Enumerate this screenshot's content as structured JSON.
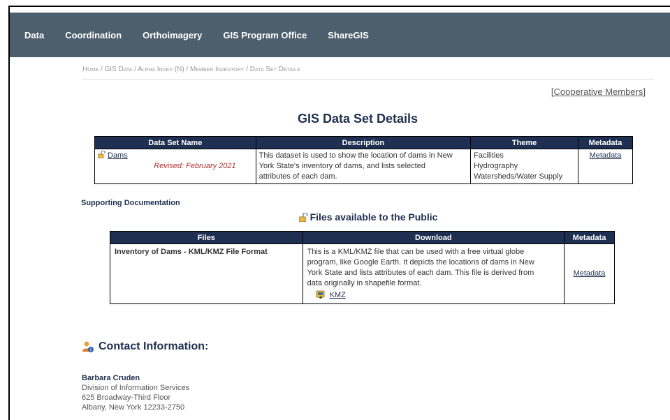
{
  "nav": {
    "items": [
      "Data",
      "Coordination",
      "Orthoimagery",
      "GIS Program Office",
      "ShareGIS"
    ]
  },
  "breadcrumb": "Home / GIS Data / Alpha Index (N) / Member Inventory / Data Set Details",
  "cooperative_link": "Cooperative Members",
  "page_title": "GIS Data Set Details",
  "dataset_table": {
    "headers": [
      "Data Set Name",
      "Description",
      "Theme",
      "Metadata"
    ],
    "row": {
      "name": "Dams",
      "revised": "Revised: February 2021",
      "description_lines": [
        "This dataset is used to show the location of dams in New",
        "York State's inventory of dams, and lists selected",
        "attributes of each dam."
      ],
      "themes": [
        "Facilities",
        "Hydrography",
        "Watersheds/Water Supply"
      ],
      "metadata": "Metadata"
    }
  },
  "supporting_title": "Supporting Documentation",
  "files_title": "Files available to the Public",
  "files_table": {
    "headers": [
      "Files",
      "Download",
      "Metadata"
    ],
    "row": {
      "file": "Inventory of Dams - KML/KMZ File Format",
      "download_lines": [
        "This is a KML/KMZ file that can be used with a free virtual globe",
        "program, like Google Earth. It depicts the locations of dams in New",
        "York State and lists attributes of each dam. This file is derived from",
        "data originally in shapefile format."
      ],
      "download_link": "KMZ",
      "metadata": "Metadata"
    }
  },
  "contact": {
    "title": "Contact Information:",
    "name": "Barbara Cruden",
    "lines": [
      "Division of Information Services",
      "625 Broadway-Third Floor",
      "Albany, New York  12233-2750"
    ]
  },
  "colors": {
    "navbar": "#4d5f6d",
    "table_header": "#1f2f52",
    "title": "#1f3050",
    "revised": "#b03030"
  }
}
